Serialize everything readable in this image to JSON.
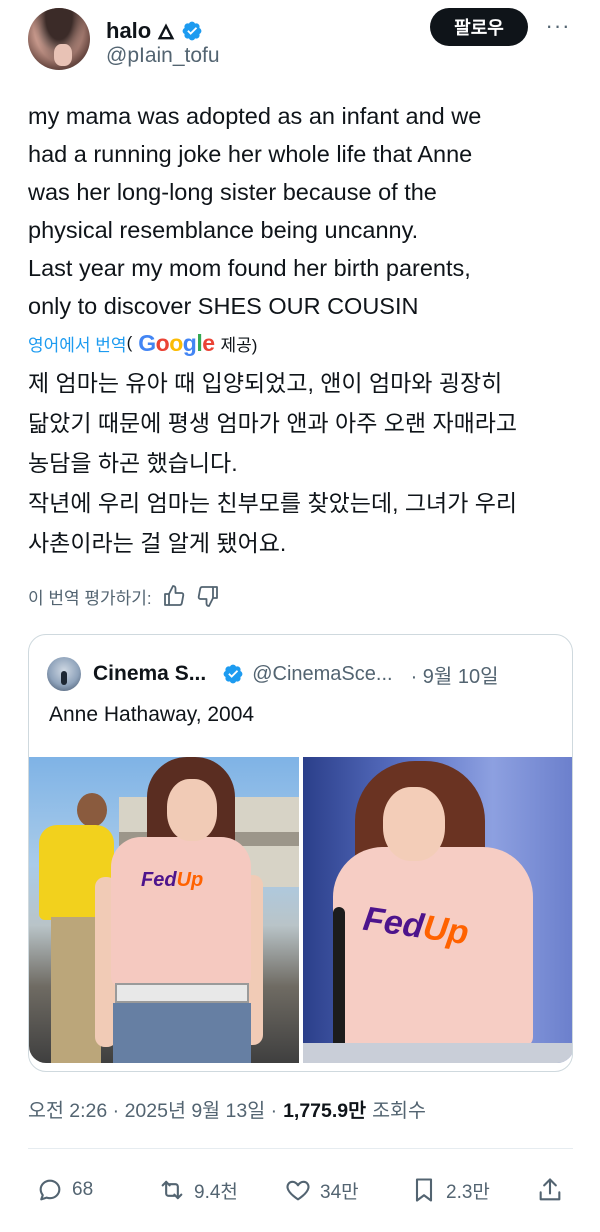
{
  "author": {
    "name": "halo",
    "name_emoji": "🜂",
    "handle": "@pIain_tofu"
  },
  "header": {
    "follow_label": "팔로우",
    "more_label": "···"
  },
  "tweet": {
    "lines": [
      "my mama was adopted as an infant and we",
      "had a running joke her whole life that Anne",
      "was her long-long sister because of the",
      "physical resemblance being uncanny.",
      "Last year my mom found her birth parents,",
      "only to discover SHES OUR COUSIN"
    ]
  },
  "translation": {
    "link_label": "영어에서 번역",
    "paren_open": "(",
    "provider": "Google",
    "provided_label": "제공)",
    "lines": [
      "제 엄마는 유아 때 입양되었고, 앤이 엄마와 굉장히",
      "닮았기 때문에 평생 엄마가 앤과 아주 오랜 자매라고",
      "농담을 하곤 했습니다.",
      "작년에 우리 엄마는 친부모를 찾았는데, 그녀가 우리",
      "사촌이라는 걸 알게 됐어요."
    ],
    "rate_label": "이 번역 평가하기:"
  },
  "quote": {
    "name": "Cinema S...",
    "handle": "@CinemaSce...",
    "date": "· 9월 10일",
    "text": "Anne Hathaway, 2004",
    "shirt_text_fed": "Fed",
    "shirt_text_up": "Up"
  },
  "meta": {
    "time_date": "오전 2:26 · 2025년 9월 13일 ·",
    "views_count": "1,775.9만",
    "views_label": "조회수"
  },
  "actions": {
    "replies": "68",
    "reposts": "9.4천",
    "likes": "34만",
    "bookmarks": "2.3만"
  },
  "colors": {
    "accent": "#1d9bf0",
    "text": "#0f1419",
    "muted": "#536471",
    "verified": "#1d9bf0"
  }
}
